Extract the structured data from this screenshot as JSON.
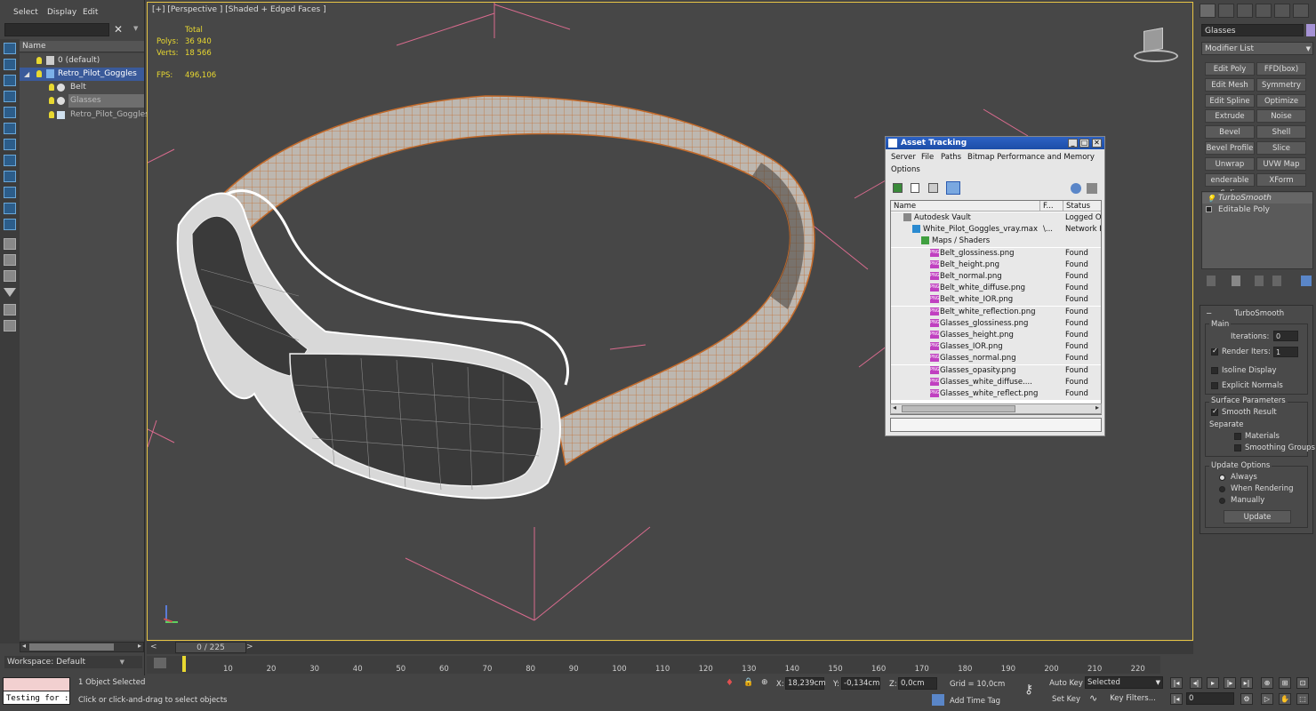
{
  "menu": {
    "select": "Select",
    "display": "Display",
    "edit": "Edit"
  },
  "explorer": {
    "column_name": "Name",
    "rows": [
      {
        "label": "0 (default)"
      },
      {
        "label": "Retro_Pilot_Goggles"
      },
      {
        "label": "Belt"
      },
      {
        "label": "Glasses"
      },
      {
        "label": "Retro_Pilot_Goggles"
      }
    ],
    "workspace": "Workspace: Default"
  },
  "viewport": {
    "label": "[+] [Perspective ] [Shaded + Edged Faces ]",
    "stats": {
      "total_label": "Total",
      "polys_label": "Polys:",
      "polys_value": "36 940",
      "verts_label": "Verts:",
      "verts_value": "18 566",
      "fps_label": "FPS:",
      "fps_value": "496,106"
    },
    "frame_counter": "0 / 225"
  },
  "timeline": {
    "ticks": [
      "10",
      "20",
      "30",
      "40",
      "50",
      "60",
      "70",
      "80",
      "90",
      "100",
      "110",
      "120",
      "130",
      "140",
      "150",
      "160",
      "170",
      "180",
      "190",
      "200",
      "210",
      "220"
    ]
  },
  "command_panel": {
    "object_name": "Glasses",
    "object_color": "#a693d6",
    "modifier_list": "Modifier List",
    "modifier_buttons": [
      [
        "Edit Poly",
        "FFD(box)"
      ],
      [
        "Edit Mesh",
        "Symmetry"
      ],
      [
        "Edit Spline",
        "Optimize"
      ],
      [
        "Extrude",
        "Noise"
      ],
      [
        "Bevel",
        "Shell"
      ],
      [
        "Bevel Profile",
        "Slice"
      ],
      [
        "Unwrap UVW",
        "UVW Map"
      ],
      [
        "enderable Splin",
        "XForm"
      ]
    ],
    "stack": [
      "TurboSmooth",
      "Editable Poly"
    ],
    "turbosmooth": {
      "title": "TurboSmooth",
      "main": "Main",
      "iterations_label": "Iterations:",
      "iterations_value": "0",
      "render_iters_label": "Render Iters:",
      "render_iters_value": "1",
      "isoline": "Isoline Display",
      "explicit_normals": "Explicit Normals",
      "surface_params": "Surface Parameters",
      "smooth_result": "Smooth Result",
      "separate": "Separate",
      "materials": "Materials",
      "smoothing_groups": "Smoothing Groups",
      "update_options": "Update Options",
      "always": "Always",
      "when_rendering": "When Rendering",
      "manually": "Manually",
      "update_button": "Update"
    }
  },
  "asset_tracking": {
    "title": "Asset Tracking",
    "menu": [
      "Server",
      "File",
      "Paths",
      "Bitmap Performance and Memory",
      "Options"
    ],
    "columns": [
      "Name",
      "F...",
      "Status"
    ],
    "rows": [
      {
        "name": "Autodesk Vault",
        "f": "",
        "status": "Logged Ou",
        "indent": 1,
        "icon": "vault"
      },
      {
        "name": "White_Pilot_Goggles_vray.max",
        "f": "\\...",
        "status": "Network Pa",
        "indent": 2,
        "icon": "max"
      },
      {
        "name": "Maps / Shaders",
        "f": "",
        "status": "",
        "indent": 3,
        "icon": "maps"
      },
      {
        "name": "Belt_glossiness.png",
        "f": "",
        "status": "Found",
        "indent": 4,
        "icon": "png"
      },
      {
        "name": "Belt_height.png",
        "f": "",
        "status": "Found",
        "indent": 4,
        "icon": "png"
      },
      {
        "name": "Belt_normal.png",
        "f": "",
        "status": "Found",
        "indent": 4,
        "icon": "png"
      },
      {
        "name": "Belt_white_diffuse.png",
        "f": "",
        "status": "Found",
        "indent": 4,
        "icon": "png"
      },
      {
        "name": "Belt_white_IOR.png",
        "f": "",
        "status": "Found",
        "indent": 4,
        "icon": "png"
      },
      {
        "name": "Belt_white_reflection.png",
        "f": "",
        "status": "Found",
        "indent": 4,
        "icon": "png"
      },
      {
        "name": "Glasses_glossiness.png",
        "f": "",
        "status": "Found",
        "indent": 4,
        "icon": "png"
      },
      {
        "name": "Glasses_height.png",
        "f": "",
        "status": "Found",
        "indent": 4,
        "icon": "png"
      },
      {
        "name": "Glasses_IOR.png",
        "f": "",
        "status": "Found",
        "indent": 4,
        "icon": "png"
      },
      {
        "name": "Glasses_normal.png",
        "f": "",
        "status": "Found",
        "indent": 4,
        "icon": "png"
      },
      {
        "name": "Glasses_opasity.png",
        "f": "",
        "status": "Found",
        "indent": 4,
        "icon": "png"
      },
      {
        "name": "Glasses_white_diffuse....",
        "f": "",
        "status": "Found",
        "indent": 4,
        "icon": "png"
      },
      {
        "name": "Glasses_white_reflect.png",
        "f": "",
        "status": "Found",
        "indent": 4,
        "icon": "png"
      }
    ],
    "png_tag": "PNG"
  },
  "status": {
    "maxscript_value": "Testing for :",
    "selected": "1 Object Selected",
    "prompt": "Click or click-and-drag to select objects",
    "x_label": "X:",
    "x_value": "18,239cm",
    "y_label": "Y:",
    "y_value": "-0,134cm",
    "z_label": "Z:",
    "z_value": "0,0cm",
    "grid": "Grid = 10,0cm",
    "add_time_tag": "Add Time Tag",
    "auto_key": "Auto Key",
    "set_key": "Set Key",
    "selected_dropdown": "Selected",
    "key_filters": "Key Filters...",
    "frame": "0"
  }
}
